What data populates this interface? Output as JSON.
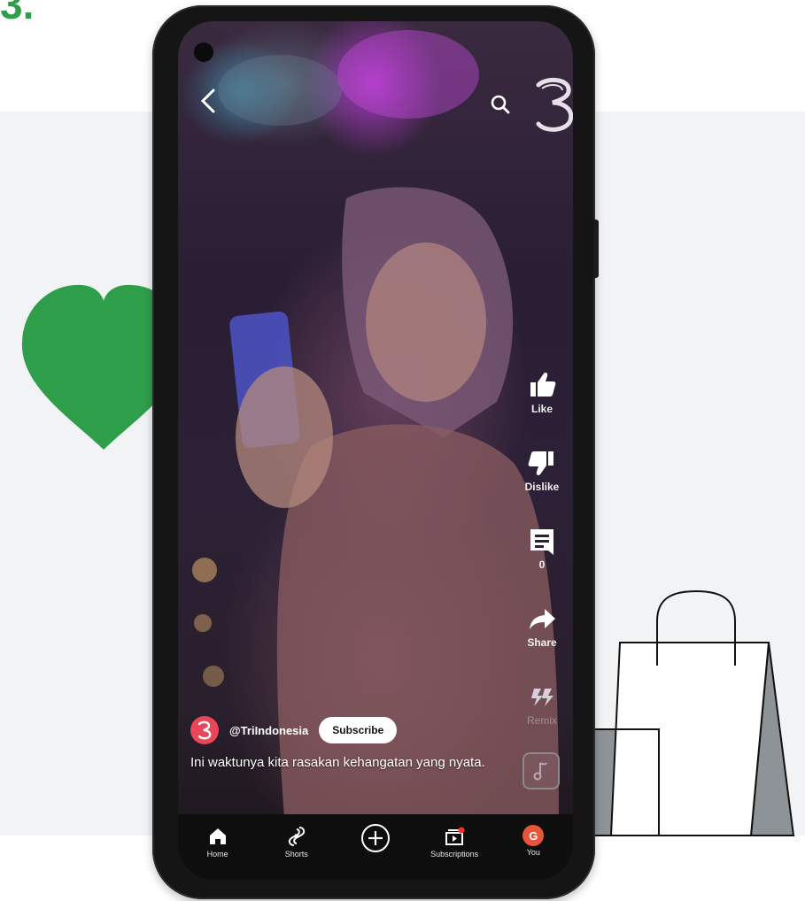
{
  "page": {
    "step_number": "3.",
    "colors": {
      "accent_green": "#2e9e4a",
      "band_gray": "#f2f3f5",
      "bag_gray": "#8e9398"
    }
  },
  "decor": {
    "heart_icon": "heart-icon",
    "bag_icon": "shopping-bag-icon"
  },
  "app": {
    "top_bar": {
      "back_icon": "arrow-left-icon",
      "search_icon": "search-icon",
      "brand_icon": "tri-logo-icon"
    },
    "actions": [
      {
        "name": "like",
        "label": "Like",
        "icon": "thumbs-up-icon"
      },
      {
        "name": "dislike",
        "label": "Dislike",
        "icon": "thumbs-down-icon"
      },
      {
        "name": "comments",
        "label": "0",
        "icon": "comment-icon"
      },
      {
        "name": "share",
        "label": "Share",
        "icon": "share-arrow-icon"
      },
      {
        "name": "remix",
        "label": "Remix",
        "icon": "remix-icon"
      }
    ],
    "sound_icon": "music-note-icon",
    "channel": {
      "handle": "@TriIndonesia",
      "subscribe_label": "Subscribe"
    },
    "caption": "Ini waktunya kita rasakan kehangatan yang nyata.",
    "nav": [
      {
        "name": "home",
        "label": "Home",
        "icon": "home-icon"
      },
      {
        "name": "shorts",
        "label": "Shorts",
        "icon": "shorts-icon"
      },
      {
        "name": "create",
        "label": "",
        "icon": "plus-circle-icon"
      },
      {
        "name": "subscriptions",
        "label": "Subscriptions",
        "icon": "subscriptions-icon"
      },
      {
        "name": "you",
        "label": "You",
        "icon": "avatar-icon",
        "avatar_letter": "G"
      }
    ]
  }
}
